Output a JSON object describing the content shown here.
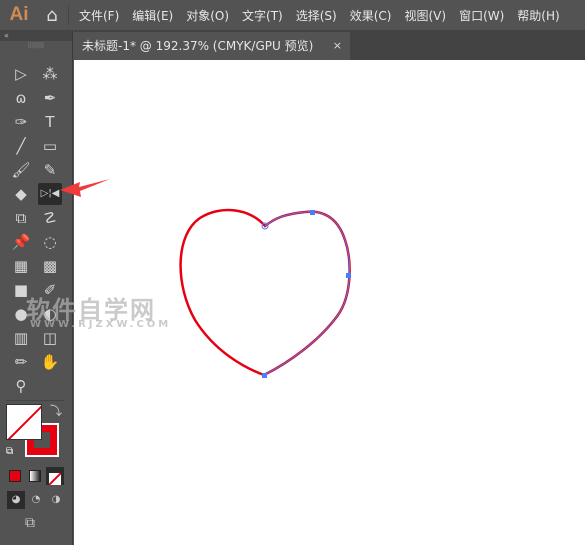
{
  "app": {
    "logo": "Ai"
  },
  "menu": [
    "文件(F)",
    "编辑(E)",
    "对象(O)",
    "文字(T)",
    "选择(S)",
    "效果(C)",
    "视图(V)",
    "窗口(W)",
    "帮助(H)"
  ],
  "document_tab": {
    "title": "未标题-1* @ 192.37% (CMYK/GPU 预览)",
    "close": "×"
  },
  "toolbar": {
    "collapse": "«",
    "tools": [
      {
        "name": "selection",
        "glyph": "▷"
      },
      {
        "name": "magic-wand",
        "glyph": "⁂"
      },
      {
        "name": "lasso",
        "glyph": "ɷ"
      },
      {
        "name": "pen",
        "glyph": "✒"
      },
      {
        "name": "curvature",
        "glyph": "✑"
      },
      {
        "name": "type",
        "glyph": "T"
      },
      {
        "name": "line-segment",
        "glyph": "╱"
      },
      {
        "name": "rectangle",
        "glyph": "▭"
      },
      {
        "name": "paintbrush",
        "glyph": "🖌"
      },
      {
        "name": "shaper",
        "glyph": "✎"
      },
      {
        "name": "eraser",
        "glyph": "◆"
      },
      {
        "name": "reflect",
        "glyph": "▷¦◀"
      },
      {
        "name": "scale",
        "glyph": "⧉"
      },
      {
        "name": "puppet-warp",
        "glyph": "☡"
      },
      {
        "name": "pin",
        "glyph": "📌"
      },
      {
        "name": "shape-builder",
        "glyph": "◌"
      },
      {
        "name": "perspective-grid",
        "glyph": "▦"
      },
      {
        "name": "mesh",
        "glyph": "▩"
      },
      {
        "name": "gradient",
        "glyph": "■"
      },
      {
        "name": "eyedropper",
        "glyph": "✐"
      },
      {
        "name": "blend",
        "glyph": "●"
      },
      {
        "name": "symbol-sprayer",
        "glyph": "◐"
      },
      {
        "name": "column-graph",
        "glyph": "▥"
      },
      {
        "name": "artboard",
        "glyph": "◫"
      },
      {
        "name": "slice",
        "glyph": "✏"
      },
      {
        "name": "hand",
        "glyph": "✋"
      },
      {
        "name": "zoom",
        "glyph": "⚲"
      }
    ],
    "selected": "reflect"
  },
  "colors": {
    "fill": "none",
    "stroke": "#e60012",
    "accent": "#e60012",
    "path_selection": "#4a7cff"
  },
  "watermark": {
    "title": "软件自学网",
    "url": "WWW.RJZXW.COM"
  }
}
